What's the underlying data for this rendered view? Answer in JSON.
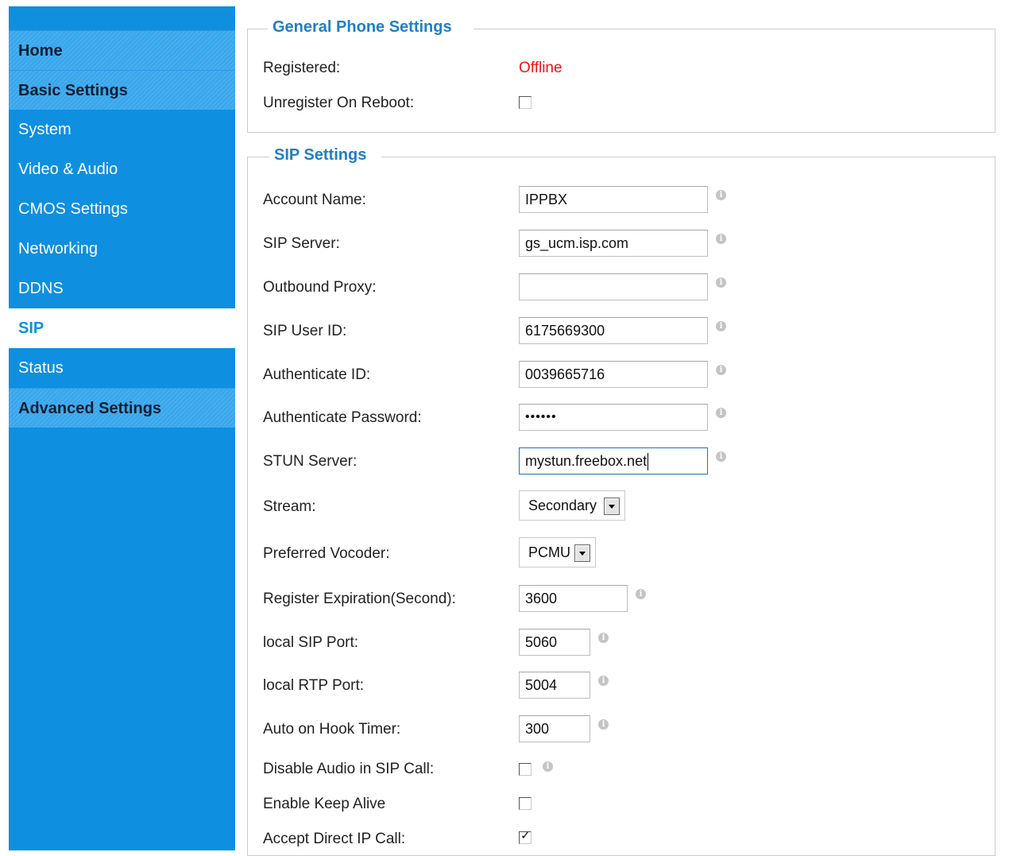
{
  "sidebar": {
    "items": [
      {
        "label": "Home"
      },
      {
        "label": "Basic Settings"
      },
      {
        "label": "System"
      },
      {
        "label": "Video & Audio"
      },
      {
        "label": "CMOS Settings"
      },
      {
        "label": "Networking"
      },
      {
        "label": "DDNS"
      },
      {
        "label": "SIP"
      },
      {
        "label": "Status"
      },
      {
        "label": "Advanced Settings"
      }
    ]
  },
  "general": {
    "legend": "General Phone Settings",
    "registered_label": "Registered:",
    "registered_value": "Offline",
    "unregister_label": "Unregister On Reboot:",
    "unregister_checked": false
  },
  "sip": {
    "legend": "SIP Settings",
    "account_name": {
      "label": "Account Name:",
      "value": "IPPBX"
    },
    "sip_server": {
      "label": "SIP Server:",
      "value": "gs_ucm.isp.com"
    },
    "outbound_proxy": {
      "label": "Outbound Proxy:",
      "value": ""
    },
    "sip_user_id": {
      "label": "SIP User ID:",
      "value": "6175669300"
    },
    "authenticate_id": {
      "label": "Authenticate ID:",
      "value": "0039665716"
    },
    "authenticate_password": {
      "label": "Authenticate Password:",
      "value": "••••••"
    },
    "stun_server": {
      "label": "STUN Server:",
      "value": "mystun.freebox.net"
    },
    "stream": {
      "label": "Stream:",
      "value": "Secondary"
    },
    "vocoder": {
      "label": "Preferred Vocoder:",
      "value": "PCMU"
    },
    "register_expiration": {
      "label": "Register Expiration(Second):",
      "value": "3600"
    },
    "local_sip_port": {
      "label": "local SIP Port:",
      "value": "5060"
    },
    "local_rtp_port": {
      "label": "local RTP Port:",
      "value": "5004"
    },
    "auto_on_hook": {
      "label": "Auto on Hook Timer:",
      "value": "300"
    },
    "disable_audio": {
      "label": "Disable Audio in SIP Call:",
      "checked": false
    },
    "keep_alive": {
      "label": "Enable Keep Alive",
      "checked": false
    },
    "direct_ip": {
      "label": "Accept Direct IP Call:",
      "checked": true
    }
  },
  "icons": {
    "info": "info-icon",
    "checkmark": "✓",
    "info_glyph": "i"
  },
  "colors": {
    "sidebar_bg": "#0e8fe0",
    "legend": "#1f7fc7",
    "offline": "#ee1111"
  }
}
